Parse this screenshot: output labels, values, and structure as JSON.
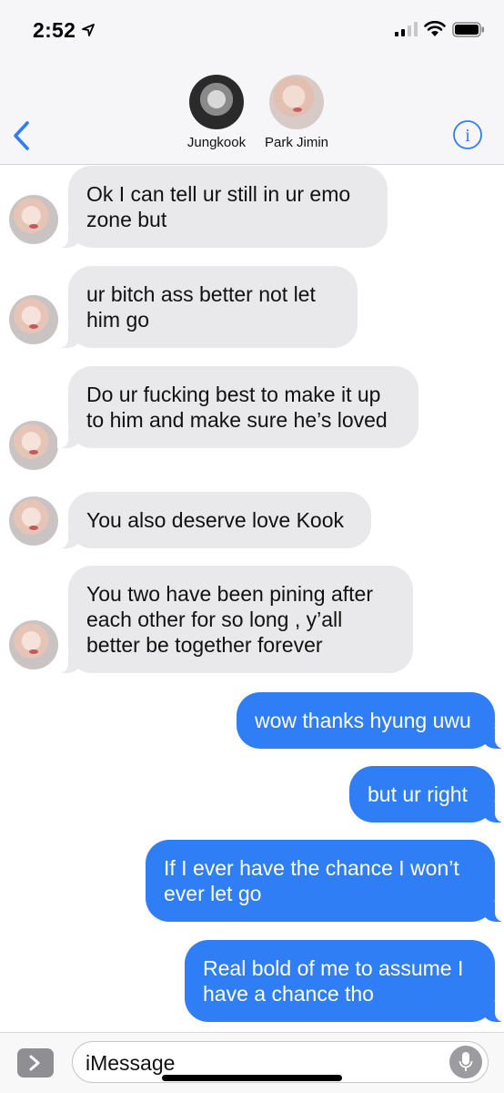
{
  "status_bar": {
    "time": "2:52",
    "location_icon": "location-arrow-icon",
    "signal_icon": "cellular-signal-icon",
    "wifi_icon": "wifi-icon",
    "battery_icon": "battery-icon"
  },
  "header": {
    "back_icon": "chevron-left-icon",
    "info_icon": "info-icon",
    "contacts": [
      {
        "name": "Jungkook"
      },
      {
        "name": "Park Jimin"
      }
    ]
  },
  "messages": [
    {
      "direction": "incoming",
      "sender": "Park Jimin",
      "text": "Ok I can tell ur still in ur emo zone but"
    },
    {
      "direction": "incoming",
      "sender": "Park Jimin",
      "text": "ur bitch ass better not let him go"
    },
    {
      "direction": "incoming",
      "sender": "Park Jimin",
      "text": "Do ur fucking best to make it up to him and make sure he’s loved"
    },
    {
      "direction": "incoming",
      "sender": "Park Jimin",
      "text": "You also deserve love Kook"
    },
    {
      "direction": "incoming",
      "sender": "Park Jimin",
      "text": "You two have been pining after each other for so long , y’all better be together forever"
    },
    {
      "direction": "outgoing",
      "text": "wow thanks hyung uwu"
    },
    {
      "direction": "outgoing",
      "text": "but ur right"
    },
    {
      "direction": "outgoing",
      "text": "If I ever have the chance I won’t ever let go"
    },
    {
      "direction": "outgoing",
      "text": "Real bold of me to assume I have a chance tho"
    }
  ],
  "composer": {
    "apps_icon": "chevron-right-icon",
    "placeholder": "iMessage",
    "mic_icon": "microphone-icon"
  },
  "colors": {
    "incoming_bubble": "#e9e9eb",
    "outgoing_bubble": "#2f7ef6",
    "accent": "#2f7ef6"
  }
}
